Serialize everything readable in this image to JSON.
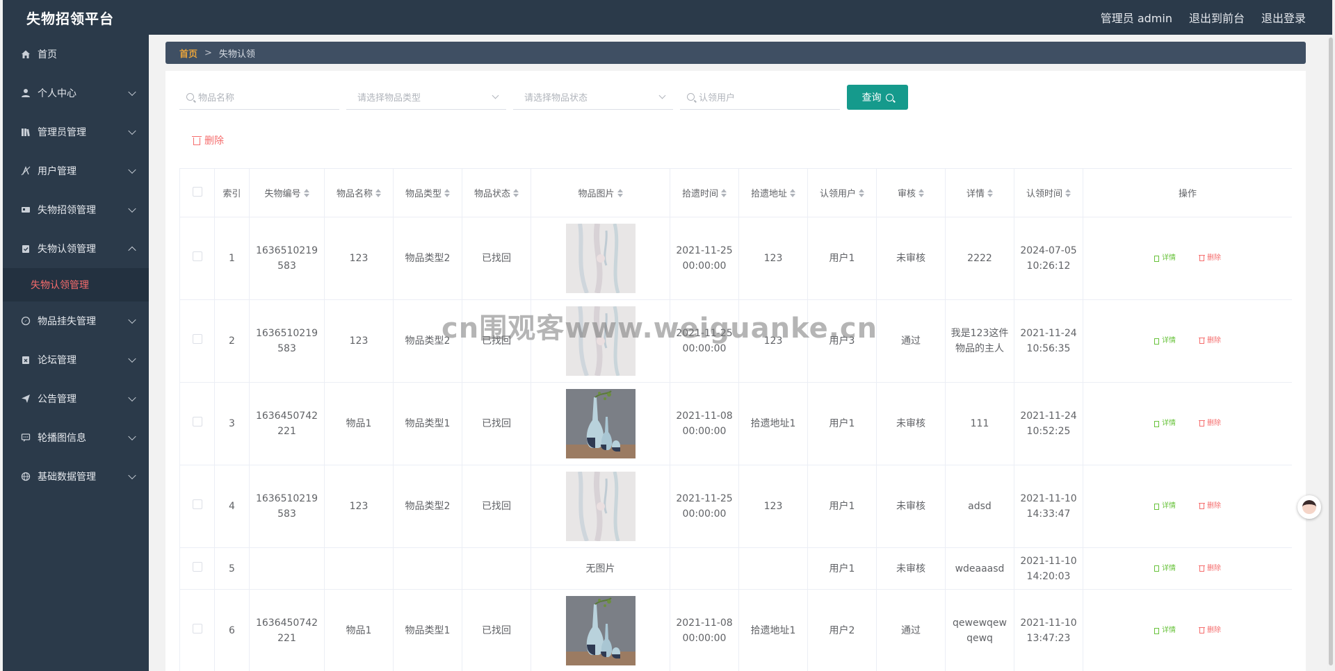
{
  "app": {
    "title": "失物招领平台"
  },
  "header": {
    "admin_label": "管理员 admin",
    "front_label": "退出到前台",
    "logout_label": "退出登录"
  },
  "sidebar": {
    "items": [
      {
        "label": "首页",
        "icon": "home-icon",
        "expandable": false
      },
      {
        "label": "个人中心",
        "icon": "user-icon",
        "expandable": true
      },
      {
        "label": "管理员管理",
        "icon": "admin-icon",
        "expandable": true
      },
      {
        "label": "用户管理",
        "icon": "users-icon",
        "expandable": true
      },
      {
        "label": "失物招领管理",
        "icon": "card-icon",
        "expandable": true
      },
      {
        "label": "失物认领管理",
        "icon": "clipboard-icon",
        "expandable": true,
        "expanded": true
      },
      {
        "label": "物品挂失管理",
        "icon": "compass-icon",
        "expandable": true
      },
      {
        "label": "论坛管理",
        "icon": "forum-icon",
        "expandable": true
      },
      {
        "label": "公告管理",
        "icon": "send-icon",
        "expandable": true
      },
      {
        "label": "轮播图信息",
        "icon": "chat-icon",
        "expandable": true
      },
      {
        "label": "基础数据管理",
        "icon": "globe-icon",
        "expandable": true
      }
    ],
    "sub_item": "失物认领管理"
  },
  "breadcrumb": {
    "home": "首页",
    "sep": ">",
    "current": "失物认领"
  },
  "search": {
    "name_placeholder": "物品名称",
    "type_placeholder": "请选择物品类型",
    "status_placeholder": "请选择物品状态",
    "user_placeholder": "认领用户",
    "query_label": "查询"
  },
  "toolbar": {
    "delete_label": "删除"
  },
  "table": {
    "headers": [
      "索引",
      "失物编号",
      "物品名称",
      "物品类型",
      "物品状态",
      "物品图片",
      "拾遗时间",
      "拾遗地址",
      "认领用户",
      "审核",
      "详情",
      "认领时间",
      "操作"
    ],
    "detail_label": "详情",
    "delete_label": "删除",
    "no_image_label": "无图片",
    "rows": [
      {
        "index": "1",
        "code": "1636510219583",
        "name": "123",
        "type": "物品类型2",
        "status": "已找回",
        "image": "paper",
        "time": "2021-11-25 00:00:00",
        "address": "123",
        "user": "用户1",
        "audit": "未审核",
        "detail": "2222",
        "claim_time": "2024-07-05 10:26:12"
      },
      {
        "index": "2",
        "code": "1636510219583",
        "name": "123",
        "type": "物品类型2",
        "status": "已找回",
        "image": "paper",
        "time": "2021-11-25 00:00:00",
        "address": "123",
        "user": "用户3",
        "audit": "通过",
        "detail": "我是123这件物品的主人",
        "claim_time": "2021-11-24 10:56:35"
      },
      {
        "index": "3",
        "code": "1636450742221",
        "name": "物品1",
        "type": "物品类型1",
        "status": "已找回",
        "image": "vase",
        "time": "2021-11-08 00:00:00",
        "address": "拾遗地址1",
        "user": "用户1",
        "audit": "未审核",
        "detail": "111",
        "claim_time": "2021-11-24 10:52:25"
      },
      {
        "index": "4",
        "code": "1636510219583",
        "name": "123",
        "type": "物品类型2",
        "status": "已找回",
        "image": "paper",
        "time": "2021-11-25 00:00:00",
        "address": "123",
        "user": "用户1",
        "audit": "未审核",
        "detail": "adsd",
        "claim_time": "2021-11-10 14:33:47"
      },
      {
        "index": "5",
        "code": "",
        "name": "",
        "type": "",
        "status": "",
        "image": "none",
        "time": "",
        "address": "",
        "user": "用户1",
        "audit": "未审核",
        "detail": "wdeaaasd",
        "claim_time": "2021-11-10 14:20:03"
      },
      {
        "index": "6",
        "code": "1636450742221",
        "name": "物品1",
        "type": "物品类型1",
        "status": "已找回",
        "image": "vase",
        "time": "2021-11-08 00:00:00",
        "address": "拾遗地址1",
        "user": "用户2",
        "audit": "通过",
        "detail": "qewewqewqewq",
        "claim_time": "2021-11-10 13:47:23"
      }
    ]
  },
  "watermark": "cn围观客www.weiguanke.cn",
  "colors": {
    "sidebar_bg": "#2b3a4a",
    "accent": "#159a8c",
    "danger": "#f56c6c",
    "success": "#67c23a",
    "breadcrumb_home": "#e6a23c"
  }
}
